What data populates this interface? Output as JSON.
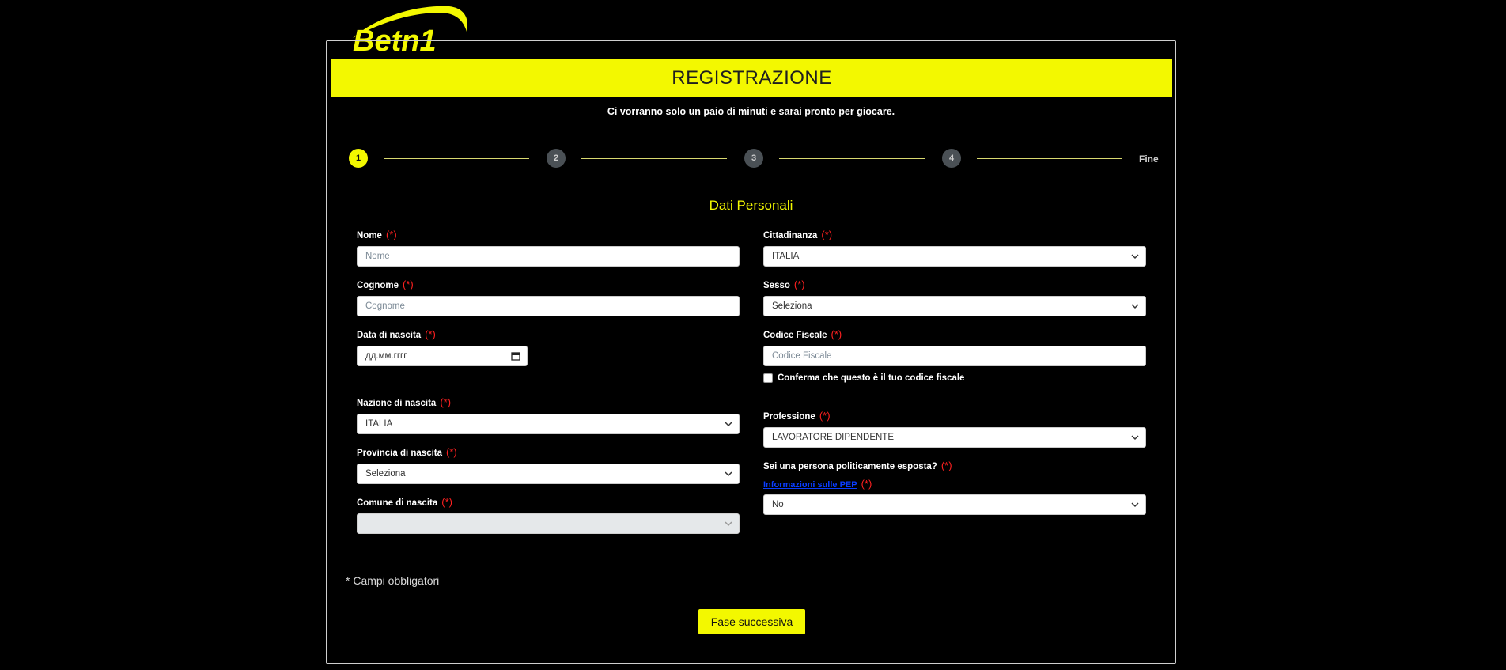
{
  "logo": {
    "text": "Betn1"
  },
  "header": {
    "title": "REGISTRAZIONE",
    "subtitle": "Ci vorranno solo un paio di minuti e sarai pronto per giocare."
  },
  "stepper": {
    "steps": [
      "1",
      "2",
      "3",
      "4"
    ],
    "final_label": "Fine",
    "active_step": 1
  },
  "section": {
    "title": "Dati Personali"
  },
  "required_mark": "(*)",
  "left": {
    "nome": {
      "label": "Nome",
      "placeholder": "Nome"
    },
    "cognome": {
      "label": "Cognome",
      "placeholder": "Cognome"
    },
    "data_nascita": {
      "label": "Data di nascita",
      "placeholder": "дд.мм.гггг"
    },
    "nazione": {
      "label": "Nazione di nascita",
      "value": "ITALIA"
    },
    "provincia": {
      "label": "Provincia di nascita",
      "value": "Seleziona"
    },
    "comune": {
      "label": "Comune di nascita",
      "value": ""
    }
  },
  "right": {
    "cittadinanza": {
      "label": "Cittadinanza",
      "value": "ITALIA"
    },
    "sesso": {
      "label": "Sesso",
      "value": "Seleziona"
    },
    "codice_fiscale": {
      "label": "Codice Fiscale",
      "placeholder": "Codice Fiscale"
    },
    "conferma": {
      "label": "Conferma che questo è il tuo codice fiscale"
    },
    "professione": {
      "label": "Professione",
      "value": "LAVORATORE DIPENDENTE"
    },
    "pep": {
      "label": "Sei una persona politicamente esposta?",
      "link": "Informazioni sulle PEP",
      "value": "No"
    }
  },
  "footer": {
    "note": "* Campi obbligatori",
    "next_button": "Fase successiva"
  },
  "colors": {
    "accent": "#f3f800",
    "required": "#ff2020",
    "background": "#000000"
  }
}
